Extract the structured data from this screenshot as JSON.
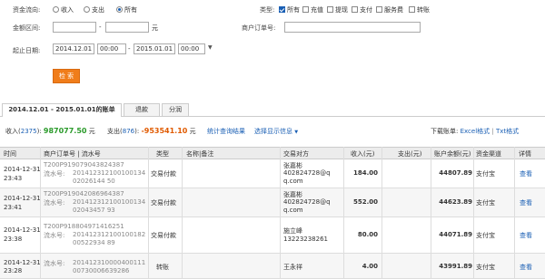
{
  "filters": {
    "direction_label": "资金流向:",
    "direction_options": [
      "收入",
      "支出",
      "所有"
    ],
    "direction_selected": 2,
    "type_label": "类型:",
    "type_options": [
      "所有",
      "充值",
      "提现",
      "支付",
      "服务费",
      "转账"
    ],
    "type_checked": [
      true,
      false,
      false,
      false,
      false,
      false
    ],
    "amount_label": "金额区间:",
    "amount_from": "",
    "amount_to": "",
    "amount_unit": "元",
    "order_label": "商户订单号:",
    "order_value": "",
    "date_label": "起止日期:",
    "date_from": "2014.12.01",
    "time_from": "00:00",
    "date_to": "2015.01.01",
    "time_to": "00:00",
    "dash": "-",
    "search_button": "检 索"
  },
  "tabs": [
    {
      "label": "2014.12.01 - 2015.01.01的账单"
    },
    {
      "label": "退款"
    },
    {
      "label": "分润"
    }
  ],
  "summary": {
    "income_prefix": "收入(",
    "income_count": "2375",
    "income_mid": "):",
    "income_amount": "987077.50",
    "expense_prefix": "支出(",
    "expense_count": "876",
    "expense_mid": "):",
    "expense_amount": "-953541.10",
    "unit": "元",
    "stats_link": "统计查询结果",
    "display_link": "选择显示信息",
    "download_label": "下载账单:",
    "excel_link": "Excel格式",
    "sep": "|",
    "txt_link": "Txt格式"
  },
  "table": {
    "headers": [
      "时间",
      "商户订单号 | 流水号",
      "类型",
      "名称|备注",
      "交易对方",
      "收入(元)",
      "支出(元)",
      "账户余额(元)",
      "资金渠道",
      "详情"
    ],
    "rows": [
      {
        "date": "2014-12-31",
        "time": "23:43",
        "order": "T200P919079043824387",
        "serial_prefix": "流水号: ",
        "serial": "20141231210010013402026144 50",
        "type": "交易付款",
        "name": "",
        "party": "张嘉彬",
        "party2": "402824728@q",
        "party3": "q.com",
        "income": "184.00",
        "expense": "",
        "balance": "44807.89",
        "channel": "支付宝",
        "detail": "查看"
      },
      {
        "date": "2014-12-31",
        "time": "23:41",
        "order": "T200P919042086964387",
        "serial_prefix": "流水号: ",
        "serial": "20141231210010013402043457 93",
        "type": "交易付款",
        "name": "",
        "party": "张嘉彬",
        "party2": "402824728@q",
        "party3": "q.com",
        "income": "552.00",
        "expense": "",
        "balance": "44623.89",
        "channel": "支付宝",
        "detail": "查看"
      },
      {
        "date": "2014-12-31",
        "time": "23:38",
        "order": "T200P918804971416251",
        "serial_prefix": "流水号: ",
        "serial": "20141231210010018200522934 89",
        "type": "交易付款",
        "name": "",
        "party": "施立峰",
        "party2": "13223238261",
        "party3": "",
        "income": "80.00",
        "expense": "",
        "balance": "44071.89",
        "channel": "支付宝",
        "detail": "查看"
      },
      {
        "date": "2014-12-31",
        "time": "23:28",
        "order": "",
        "serial_prefix": "流水号: ",
        "serial": "20141231000040011100730006639286",
        "type": "转账",
        "name": "",
        "party": "王永祥",
        "party2": "",
        "party3": "",
        "income": "4.00",
        "expense": "",
        "balance": "43991.89",
        "channel": "支付宝",
        "detail": "查看"
      }
    ]
  },
  "colors": {
    "accent": "#f07d1a",
    "link": "#1a5fb4",
    "income": "#2a9a2a",
    "expense": "#e05a00"
  }
}
